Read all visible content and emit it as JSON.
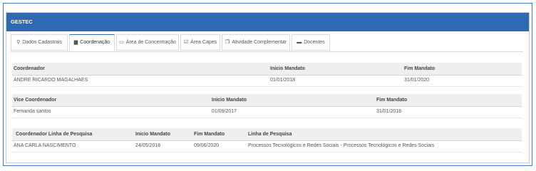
{
  "panel": {
    "title": "GESTEC"
  },
  "tabs": [
    {
      "label": "Dados Cadastrais",
      "icon": "map-pin-icon",
      "glyph": "⚲"
    },
    {
      "label": "Coordenação",
      "icon": "id-card-icon",
      "glyph": "▆"
    },
    {
      "label": "Área de Concentração",
      "icon": "folder-open-icon",
      "glyph": "▭"
    },
    {
      "label": "Área Capes",
      "icon": "checkbox-icon",
      "glyph": "☑"
    },
    {
      "label": "Atividade Complementar",
      "icon": "copy-icon",
      "glyph": "❐"
    },
    {
      "label": "Docentes",
      "icon": "briefcase-icon",
      "glyph": "▬"
    }
  ],
  "active_tab": "Coordenação",
  "coordenador": {
    "headers": [
      "Coordenador",
      "Inicio Mandato",
      "Fim Mandato"
    ],
    "row": [
      "ANDRE RICARDO MAGALHAES",
      "01/01/2018",
      "31/01/2020"
    ]
  },
  "vice": {
    "headers": [
      "Vice Coordenador",
      "Inicio Mandato",
      "Fim Mandato"
    ],
    "row": [
      "Fernanda santos",
      "01/09/2017",
      "31/01/2018"
    ]
  },
  "linha": {
    "headers": [
      "Coordenador Linha de Pesquisa",
      "Inicio Mandato",
      "Fim Mandato",
      "Linha de Pesquisa"
    ],
    "row": [
      "ANA CARLA NASCIMENTO",
      "24/05/2018",
      "09/06/2020",
      "Processos Tecnológicos e Redes Sociais - Processos Tecnológicos e Redes Sociais"
    ]
  }
}
